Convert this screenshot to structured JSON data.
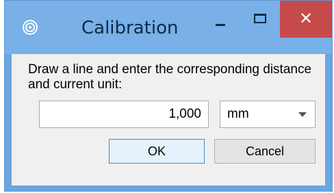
{
  "window": {
    "title": "Calibration",
    "close_glyph": "✕",
    "icons": {
      "app": "target-icon",
      "minimize": "minimize-icon",
      "maximize": "maximize-icon",
      "close": "close-icon"
    }
  },
  "dialog": {
    "prompt": "Draw a line and enter the corresponding distance and current unit:",
    "distance_value": "1,000",
    "unit_value": "mm",
    "ok_label": "OK",
    "cancel_label": "Cancel"
  },
  "colors": {
    "titlebar": "#78b0e7",
    "close_button": "#c74a4a",
    "client_bg": "#f0f0f0"
  }
}
